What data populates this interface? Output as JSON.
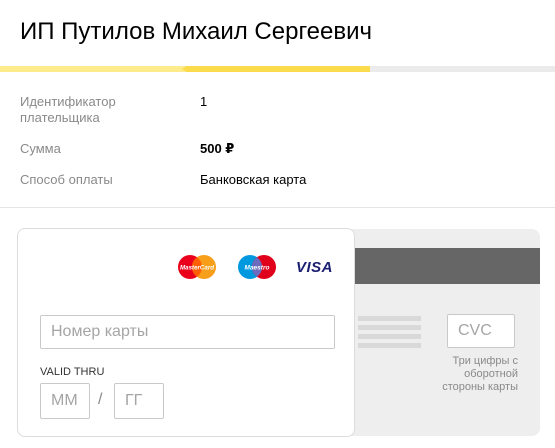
{
  "page": {
    "title": "ИП Путилов Михаил Сергеевич"
  },
  "progress": {
    "steps_total": 3,
    "current_step": 2
  },
  "payment_info": [
    {
      "label": "Идентификатор плательщика",
      "value": "1"
    },
    {
      "label": "Сумма",
      "value": "500 ₽"
    },
    {
      "label": "Способ оплаты",
      "value": "Банковская карта"
    }
  ],
  "card_form": {
    "logos": [
      "mastercard-logo",
      "maestro-logo",
      "visa-logo"
    ],
    "mastercard_text": "MasterCard",
    "maestro_text": "Maestro",
    "visa_text": "VISA",
    "card_number_placeholder": "Номер карты",
    "valid_thru_label": "VALID THRU",
    "month_placeholder": "ММ",
    "separator": "/",
    "year_placeholder": "ГГ",
    "cvc_placeholder": "CVC",
    "cvc_hint": "Три цифры с оборотной стороны карты"
  },
  "colors": {
    "progress_done": "#fdeb8c",
    "progress_active": "#fcdc4d",
    "progress_track": "#ebebeb",
    "magnetic_stripe": "#666666",
    "visa_blue": "#1a1f71"
  }
}
